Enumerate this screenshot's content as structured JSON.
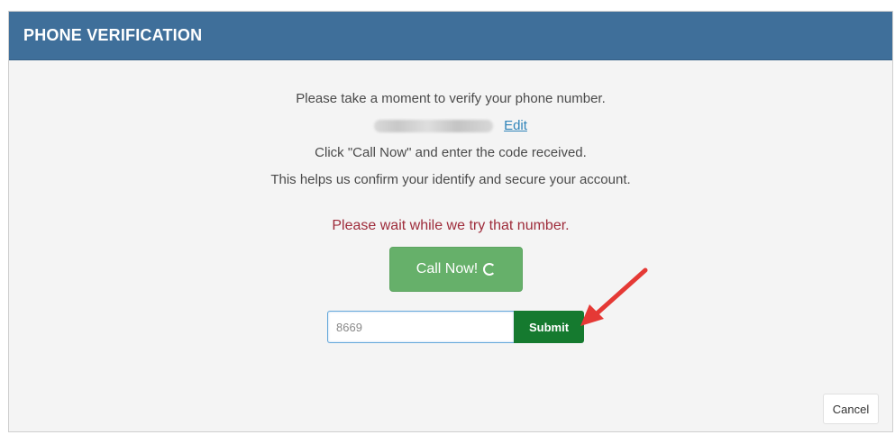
{
  "dialog": {
    "title": "PHONE VERIFICATION"
  },
  "body": {
    "line1": "Please take a moment to verify your phone number.",
    "edit_label": "Edit",
    "line3": "Click \"Call Now\" and enter the code received.",
    "line4": "This helps us confirm your identify and secure your account.",
    "wait_message": "Please wait while we try that number."
  },
  "call_button": {
    "label": "Call Now!",
    "icon": "spinner-icon"
  },
  "code_form": {
    "input_value": "8669",
    "submit_label": "Submit"
  },
  "footer": {
    "cancel_label": "Cancel"
  },
  "colors": {
    "header": "#3f6f9a",
    "call_button": "#66b06a",
    "submit_button": "#157a2f",
    "wait_text": "#9e2b3a",
    "annotation_arrow": "#e53935"
  }
}
